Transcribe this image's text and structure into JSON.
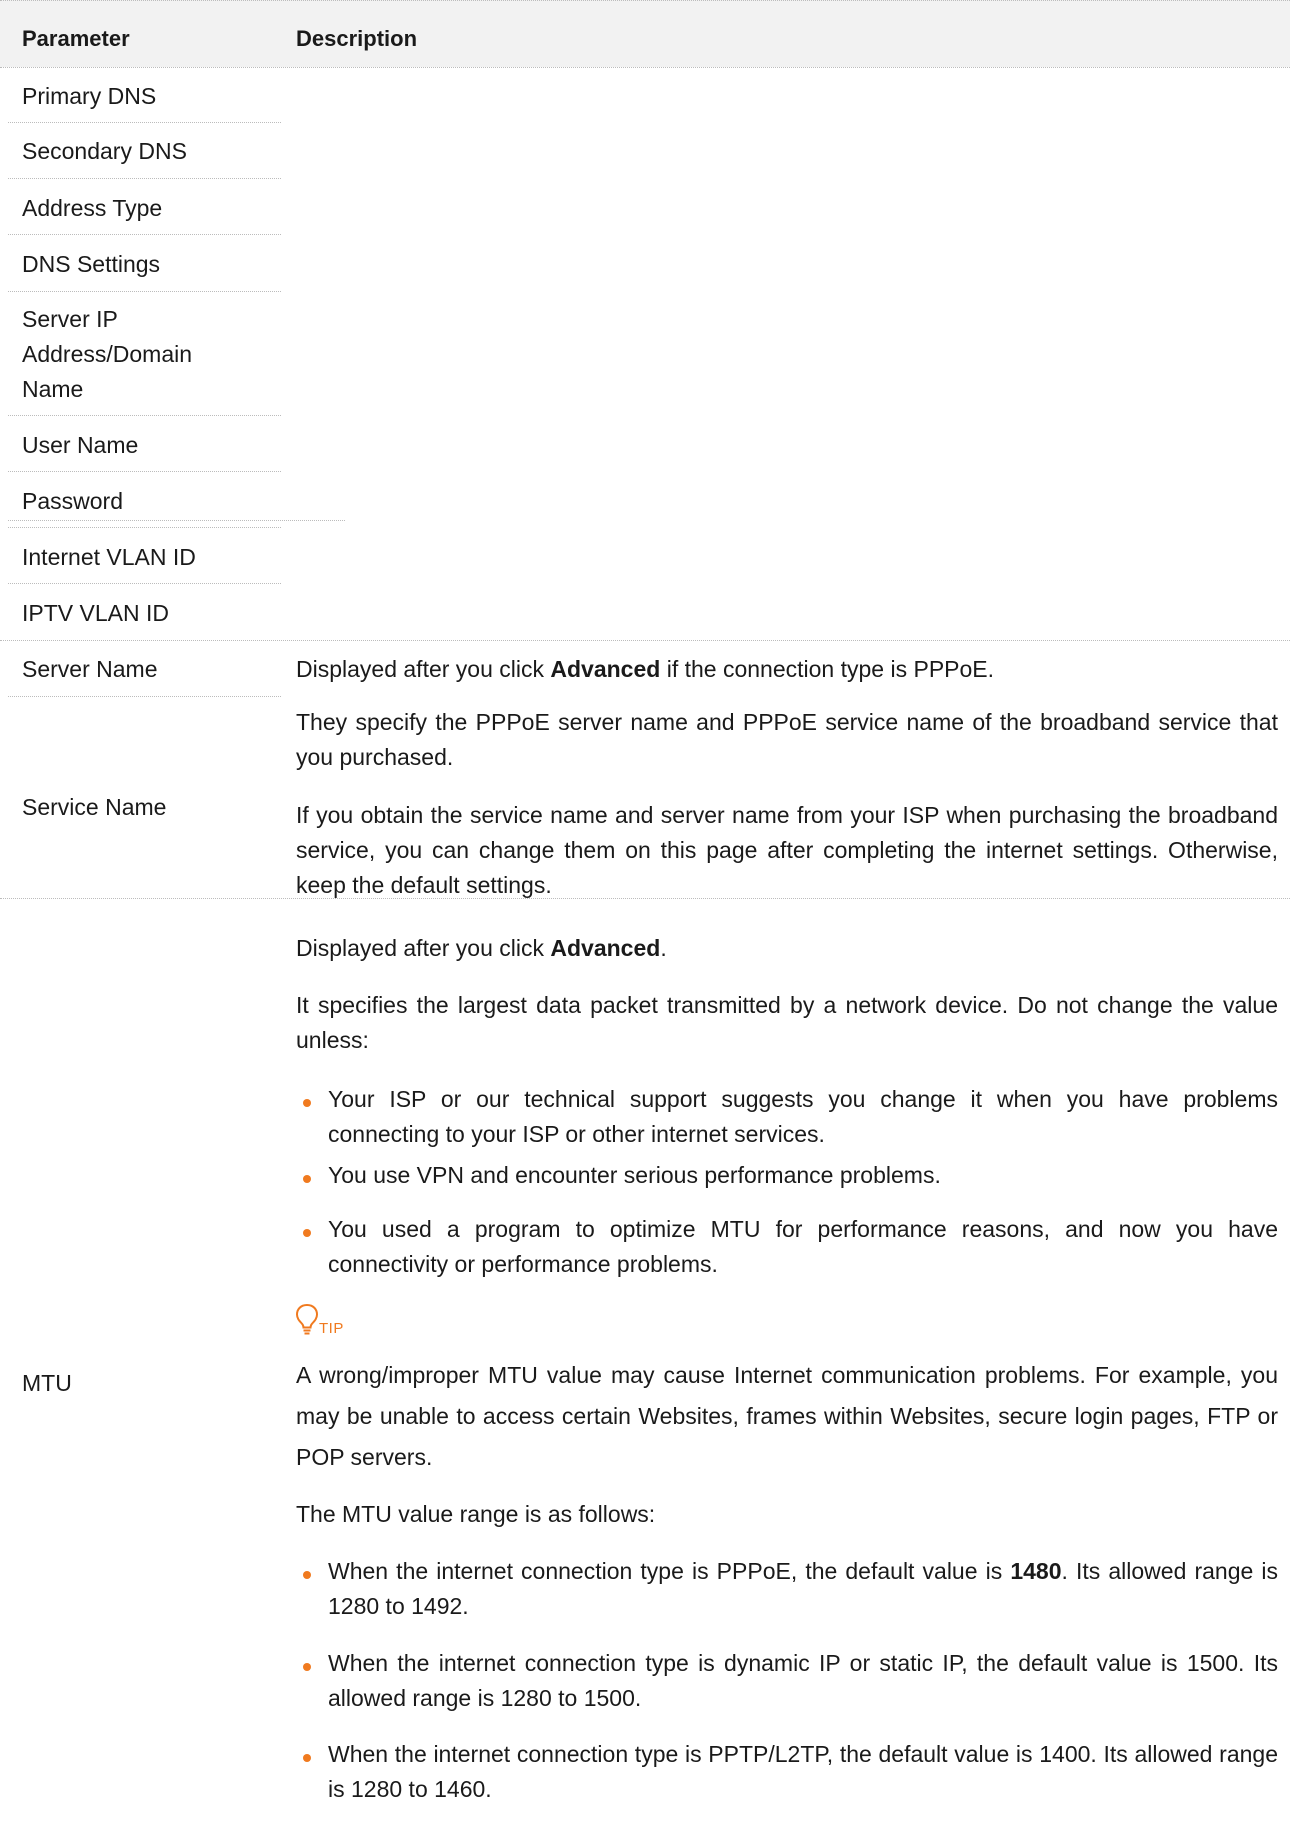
{
  "header": {
    "parameter": "Parameter",
    "description": "Description"
  },
  "params_top": [
    "Primary DNS",
    "Secondary DNS",
    "Address Type",
    "DNS Settings",
    "Server IP",
    "Address/Domain",
    "Name",
    "User Name",
    "Password",
    "Internet VLAN ID",
    "IPTV VLAN ID"
  ],
  "server_name": {
    "label": "Server Name",
    "desc_pre": "Displayed after you click ",
    "desc_bold": "Advanced",
    "desc_post": " if the connection type is PPPoE."
  },
  "service_name": {
    "label": "Service Name",
    "p1": "They specify the PPPoE server name and PPPoE service name of the broadband service that you purchased.",
    "p2": "If you obtain the service name and server name from your ISP when purchasing the broadband service, you can change them on this page after completing the internet settings. Otherwise, keep the default settings."
  },
  "mtu": {
    "label": "MTU",
    "p1_pre": "Displayed after you click ",
    "p1_bold": "Advanced",
    "p1_post": ".",
    "p2": "It specifies the largest data packet transmitted by a network device. Do not change the value unless:",
    "bullets": [
      "Your ISP or our technical support suggests you change it when you have problems connecting to your ISP or other internet services.",
      "You use VPN and encounter serious performance problems.",
      "You used a program to optimize MTU for performance reasons, and now you have connectivity or performance problems."
    ],
    "tip_label": "TIP",
    "tip_text": "A wrong/improper MTU value may cause Internet communication problems. For example, you may be unable to access certain Websites, frames within Websites, secure login pages, FTP or POP servers.",
    "range_intro": "The MTU value range is as follows:",
    "range_b1_pre": "When the internet connection type is PPPoE, the default value is ",
    "range_b1_bold": "1480",
    "range_b1_post": ". Its allowed range is 1280 to 1492.",
    "range_b2": "When the internet connection type is dynamic IP or static IP, the default value is 1500. Its allowed range is 1280 to 1500.",
    "range_b3": "When the internet connection type is PPTP/L2TP, the default value is 1400. Its allowed range is 1280 to 1460."
  },
  "colors": {
    "accent": "#f07a1f",
    "header_bg": "#f2f2f2",
    "rule": "#bcbcbc"
  }
}
